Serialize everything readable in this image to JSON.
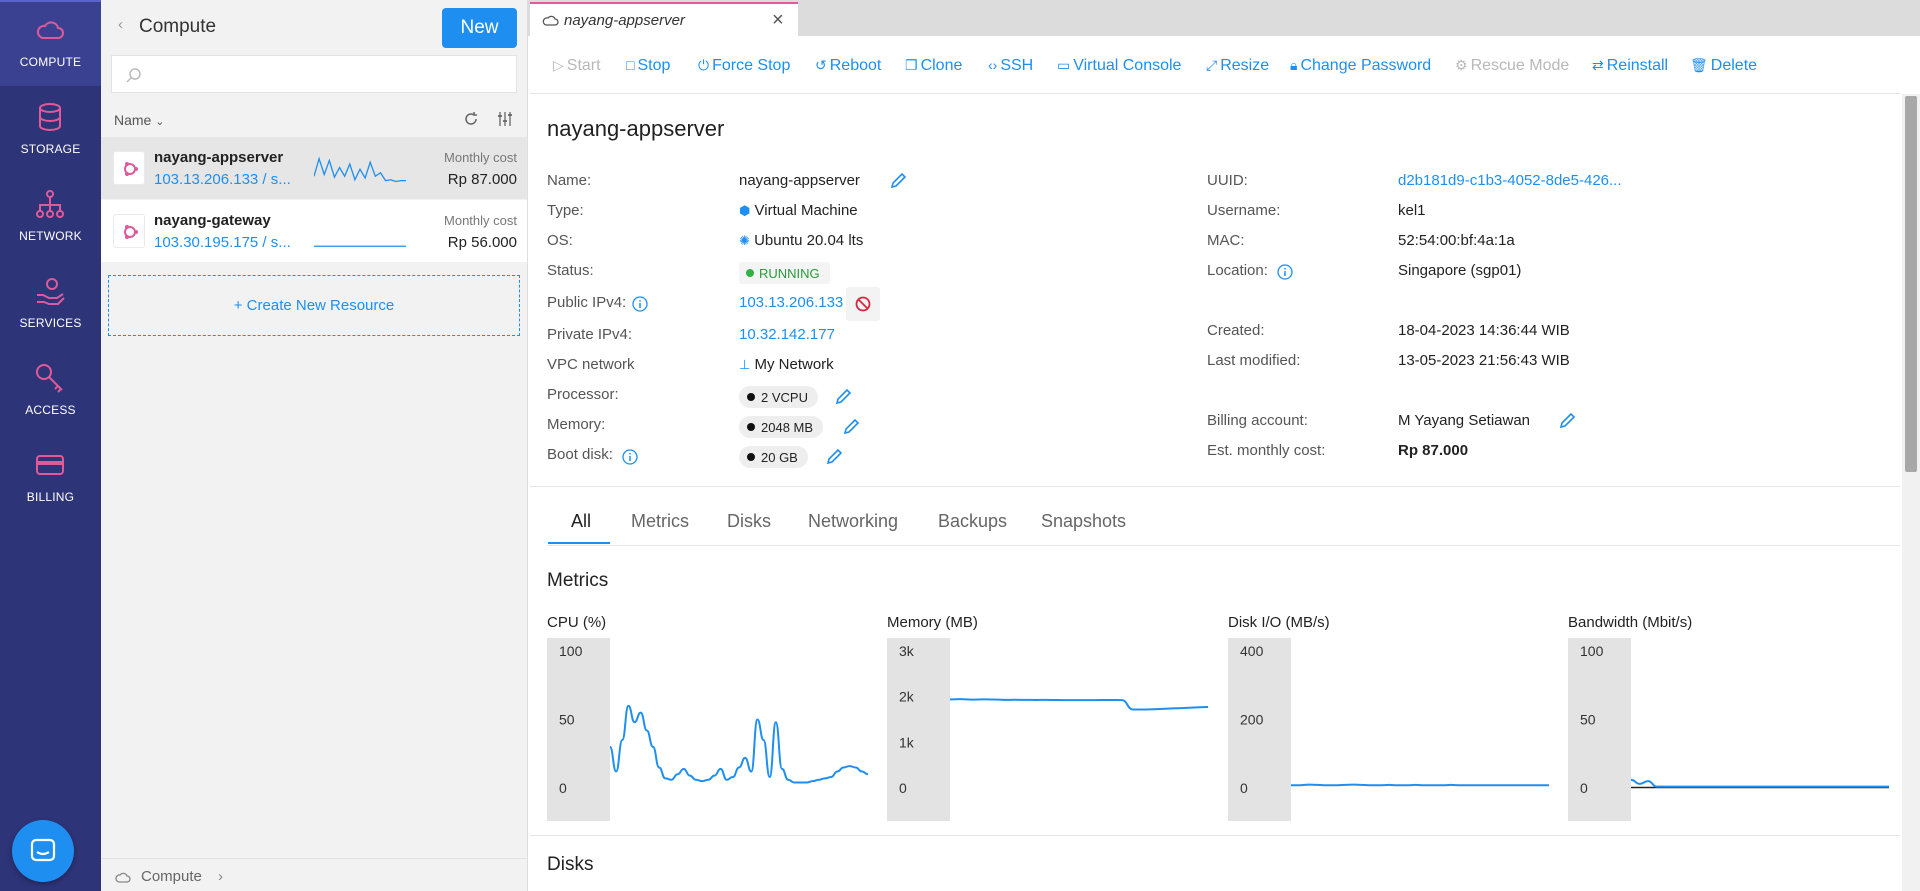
{
  "sidebar": {
    "items": [
      {
        "label": "COMPUTE",
        "icon": "cloud-icon"
      },
      {
        "label": "STORAGE",
        "icon": "database-icon"
      },
      {
        "label": "NETWORK",
        "icon": "network-icon"
      },
      {
        "label": "SERVICES",
        "icon": "services-hand-icon"
      },
      {
        "label": "ACCESS",
        "icon": "key-icon"
      },
      {
        "label": "BILLING",
        "icon": "credit-card-icon"
      }
    ],
    "active": "COMPUTE",
    "accent_color": "#e05a9a"
  },
  "list_panel": {
    "title": "Compute",
    "new_label": "New",
    "search_placeholder": "",
    "sort_label": "Name",
    "items": [
      {
        "name": "nayang-appserver",
        "sub": "103.13.206.133 / s...",
        "cost_label": "Monthly cost",
        "cost": "Rp 87.000",
        "spark": [
          10,
          30,
          12,
          28,
          9,
          20,
          10,
          24,
          6,
          18,
          8,
          26,
          10,
          14,
          5,
          6,
          4,
          5,
          5
        ],
        "selected": true
      },
      {
        "name": "nayang-gateway",
        "sub": "103.30.195.175 / s...",
        "cost_label": "Monthly cost",
        "cost": "Rp 56.000",
        "spark": [
          2,
          2,
          2,
          2,
          2,
          2,
          2,
          2,
          2,
          2,
          2,
          2,
          2,
          2,
          2,
          2
        ],
        "selected": false
      }
    ],
    "create_label": "+ Create New Resource",
    "footer": {
      "label": "Compute"
    }
  },
  "tab": {
    "title": "nayang-appserver"
  },
  "toolbar": {
    "buttons": [
      {
        "label": "Start",
        "glyph": "▷",
        "enabled": false
      },
      {
        "label": "Stop",
        "glyph": "□",
        "enabled": true
      },
      {
        "label": "Force Stop",
        "glyph": "⏻",
        "enabled": true
      },
      {
        "label": "Reboot",
        "glyph": "↺",
        "enabled": true
      },
      {
        "label": "Clone",
        "glyph": "❐",
        "enabled": true
      },
      {
        "label": "SSH",
        "glyph": "‹›",
        "enabled": true
      },
      {
        "label": "Virtual Console",
        "glyph": "▭",
        "enabled": true
      },
      {
        "label": "Resize",
        "glyph": "⤢",
        "enabled": true
      },
      {
        "label": "Change Password",
        "glyph": "🔒︎",
        "enabled": true
      },
      {
        "label": "Rescue Mode",
        "glyph": "⚙",
        "enabled": false
      },
      {
        "label": "Reinstall",
        "glyph": "⇄",
        "enabled": true
      },
      {
        "label": "Delete",
        "glyph": "🗑︎",
        "enabled": true
      }
    ]
  },
  "details": {
    "title": "nayang-appserver",
    "left": {
      "name_label": "Name:",
      "name": "nayang-appserver",
      "type_label": "Type:",
      "type": "Virtual Machine",
      "os_label": "OS:",
      "os": "Ubuntu 20.04 lts",
      "status_label": "Status:",
      "status": "RUNNING",
      "public_ipv4_label": "Public IPv4:",
      "public_ipv4": "103.13.206.133",
      "private_ipv4_label": "Private IPv4:",
      "private_ipv4": "10.32.142.177",
      "vpc_label": "VPC network",
      "vpc": "My Network",
      "processor_label": "Processor:",
      "processor": "2 VCPU",
      "memory_label": "Memory:",
      "memory": "2048 MB",
      "boot_disk_label": "Boot disk:",
      "boot_disk": "20 GB"
    },
    "right": {
      "uuid_label": "UUID:",
      "uuid": "d2b181d9-c1b3-4052-8de5-426...",
      "username_label": "Username:",
      "username": "kel1",
      "mac_label": "MAC:",
      "mac": "52:54:00:bf:4a:1a",
      "location_label": "Location:",
      "location": "Singapore (sgp01)",
      "created_label": "Created:",
      "created": "18-04-2023 14:36:44 WIB",
      "modified_label": "Last modified:",
      "modified": "13-05-2023 21:56:43 WIB",
      "billing_label": "Billing account:",
      "billing": "M Yayang Setiawan",
      "cost_label": "Est. monthly cost:",
      "cost": "Rp 87.000"
    }
  },
  "detail_tabs": [
    "All",
    "Metrics",
    "Disks",
    "Networking",
    "Backups",
    "Snapshots"
  ],
  "active_detail_tab": "All",
  "metrics_title": "Metrics",
  "disks_title": "Disks",
  "chart_data": [
    {
      "type": "line",
      "title": "CPU (%)",
      "ylim": [
        0,
        100
      ],
      "yticks": [
        "100",
        "50",
        "0"
      ],
      "tick_values": [
        100,
        50,
        0
      ],
      "color": "#1e8ff0",
      "values": [
        30,
        12,
        35,
        60,
        48,
        55,
        42,
        30,
        15,
        7,
        6,
        10,
        14,
        9,
        6,
        5,
        6,
        9,
        14,
        6,
        8,
        15,
        22,
        12,
        50,
        35,
        8,
        48,
        14,
        6,
        4,
        4,
        4,
        5,
        6,
        7,
        8,
        12,
        15,
        16,
        15,
        12,
        10
      ]
    },
    {
      "type": "line",
      "title": "Memory (MB)",
      "ylim": [
        0,
        3000
      ],
      "yticks": [
        "3k",
        "2k",
        "1k",
        "0"
      ],
      "tick_values": [
        3000,
        2000,
        1000,
        0
      ],
      "color": "#1e8ff0",
      "values": [
        1940,
        1945,
        1935,
        1942,
        1938,
        1930,
        1932,
        1930,
        1928,
        1930,
        1926,
        1925,
        1924,
        1925,
        1926,
        1927,
        1925,
        1720,
        1718,
        1725,
        1735,
        1745,
        1755,
        1765,
        1775
      ]
    },
    {
      "type": "line",
      "title": "Disk I/O (MB/s)",
      "ylim": [
        0,
        400
      ],
      "yticks": [
        "400",
        "200",
        "0"
      ],
      "tick_values": [
        400,
        200,
        0
      ],
      "color": "#1e8ff0",
      "values": [
        8,
        8,
        10,
        9,
        8,
        8,
        9,
        10,
        9,
        8,
        8,
        9,
        8,
        8,
        9,
        8,
        8,
        8,
        9,
        8,
        8,
        8,
        8,
        8,
        8,
        8,
        8,
        8,
        8,
        8
      ]
    },
    {
      "type": "line",
      "title": "Bandwidth (Mbit/s)",
      "ylim": [
        0,
        100
      ],
      "yticks": [
        "100",
        "50",
        "0"
      ],
      "tick_values": [
        100,
        50,
        0
      ],
      "color": "#1e8ff0",
      "values": [
        6,
        3,
        5,
        1,
        1,
        1,
        1,
        1,
        1,
        1,
        1,
        1,
        1,
        1,
        1,
        1,
        1,
        1,
        1,
        1,
        1,
        1,
        1,
        1,
        1,
        1,
        1,
        1,
        1,
        1,
        1
      ]
    }
  ]
}
